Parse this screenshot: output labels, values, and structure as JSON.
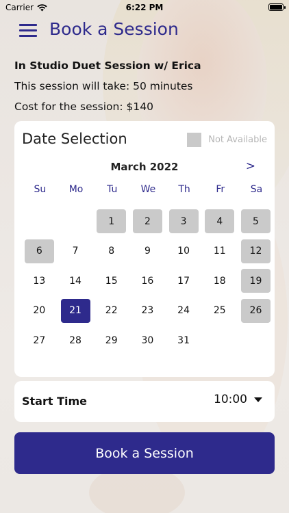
{
  "status_bar": {
    "carrier": "Carrier",
    "time": "6:22 PM"
  },
  "nav": {
    "title": "Book a Session"
  },
  "session": {
    "title": "In Studio Duet Session w/ Erica",
    "duration_text": "This session will take: 50 minutes",
    "cost_text": "Cost for the session: $140"
  },
  "date_selection": {
    "header": "Date Selection",
    "legend_label": "Not Available",
    "month": "March 2022",
    "next_label": ">",
    "weekdays": [
      "Su",
      "Mo",
      "Tu",
      "We",
      "Th",
      "Fr",
      "Sa"
    ],
    "days": [
      {
        "label": ""
      },
      {
        "label": ""
      },
      {
        "label": "1",
        "state": "unavailable"
      },
      {
        "label": "2",
        "state": "unavailable"
      },
      {
        "label": "3",
        "state": "unavailable"
      },
      {
        "label": "4",
        "state": "unavailable"
      },
      {
        "label": "5",
        "state": "unavailable"
      },
      {
        "label": "6",
        "state": "unavailable"
      },
      {
        "label": "7"
      },
      {
        "label": "8"
      },
      {
        "label": "9"
      },
      {
        "label": "10"
      },
      {
        "label": "11"
      },
      {
        "label": "12",
        "state": "unavailable"
      },
      {
        "label": "13"
      },
      {
        "label": "14"
      },
      {
        "label": "15"
      },
      {
        "label": "16"
      },
      {
        "label": "17"
      },
      {
        "label": "18"
      },
      {
        "label": "19",
        "state": "unavailable"
      },
      {
        "label": "20"
      },
      {
        "label": "21",
        "state": "selected"
      },
      {
        "label": "22"
      },
      {
        "label": "23"
      },
      {
        "label": "24"
      },
      {
        "label": "25"
      },
      {
        "label": "26",
        "state": "unavailable"
      },
      {
        "label": "27"
      },
      {
        "label": "28"
      },
      {
        "label": "29"
      },
      {
        "label": "30"
      },
      {
        "label": "31"
      }
    ]
  },
  "start_time": {
    "label": "Start Time",
    "value": "10:00"
  },
  "book_button": {
    "label": "Book a Session"
  },
  "colors": {
    "accent": "#2e2a8c",
    "unavailable": "#cacaca",
    "card": "#ffffff"
  }
}
